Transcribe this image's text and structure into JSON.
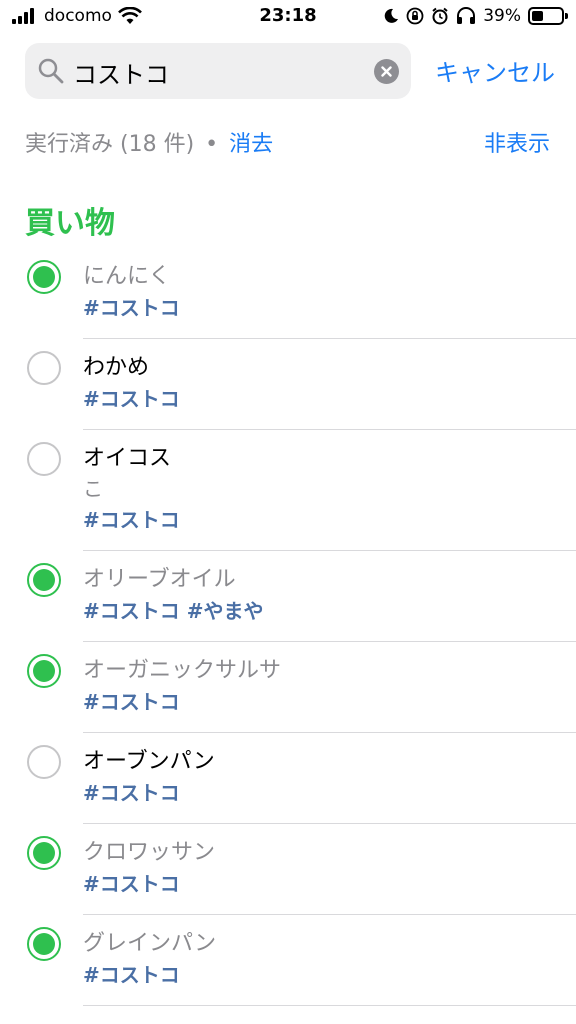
{
  "status_bar": {
    "carrier": "docomo",
    "time": "23:18",
    "battery_text": "39%",
    "battery_level": 0.39
  },
  "search": {
    "query": "コストコ",
    "cancel_label": "キャンセル"
  },
  "completed_bar": {
    "label": "実行済み (18 件)",
    "separator": "•",
    "clear_label": "消去",
    "hide_label": "非表示"
  },
  "list": {
    "title": "買い物",
    "accent_color": "#2fc04f"
  },
  "items": [
    {
      "title": "にんにく",
      "tags": "#コストコ",
      "done": true
    },
    {
      "title": "わかめ",
      "tags": "#コストコ",
      "done": false
    },
    {
      "title": "オイコス",
      "note": "こ",
      "tags": "#コストコ",
      "done": false
    },
    {
      "title": "オリーブオイル",
      "tags": "#コストコ #やまや",
      "done": true
    },
    {
      "title": "オーガニックサルサ",
      "tags": "#コストコ",
      "done": true
    },
    {
      "title": "オーブンパン",
      "tags": "#コストコ",
      "done": false
    },
    {
      "title": "クロワッサン",
      "tags": "#コストコ",
      "done": true
    },
    {
      "title": "グレインパン",
      "tags": "#コストコ",
      "done": true
    }
  ]
}
